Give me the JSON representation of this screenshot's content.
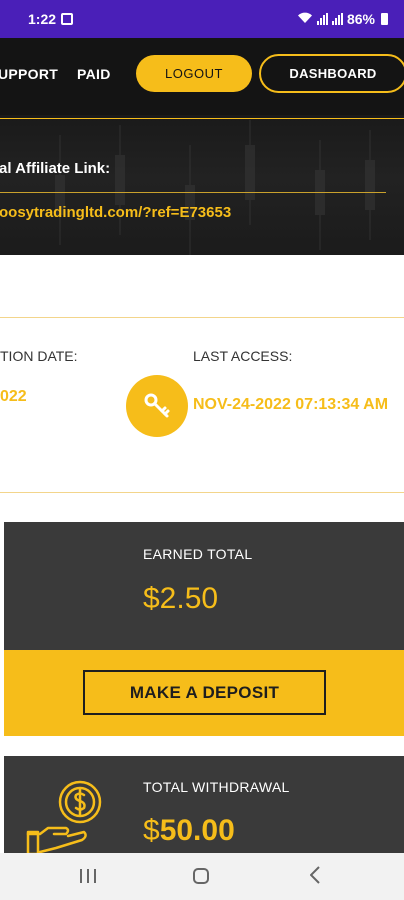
{
  "status_bar": {
    "time": "1:22",
    "battery": "86%",
    "image_icon": "image-icon",
    "wifi_icon": "wifi-icon",
    "signal_icon": "signal-icon",
    "battery_icon": "battery-icon"
  },
  "nav": {
    "support": "UPPORT",
    "paid": "PAID",
    "logout": "LOGOUT",
    "dashboard": "DASHBOARD"
  },
  "affiliate": {
    "title": "al Affiliate Link:",
    "link": "oosytradingltd.com/?ref=E73653"
  },
  "access": {
    "registration_label": "TION DATE:",
    "registration_value": "022",
    "last_access_label": "LAST ACCESS:",
    "last_access_value": "NOV-24-2022 07:13:34 AM",
    "icon": "key-icon"
  },
  "earned": {
    "label": "EARNED TOTAL",
    "value": "$2.50"
  },
  "deposit": {
    "button": "MAKE A DEPOSIT"
  },
  "withdrawal": {
    "label": "TOTAL WITHDRAWAL",
    "currency": "$",
    "value": "50.00",
    "icon": "hand-coin-icon"
  },
  "colors": {
    "accent": "#f6bd1a",
    "status_bar": "#4a1fb8",
    "nav_bg": "#141414",
    "card_bg": "#3a3a3a"
  },
  "android_nav": {
    "recents": "recents-icon",
    "home": "home-icon",
    "back": "back-icon"
  }
}
